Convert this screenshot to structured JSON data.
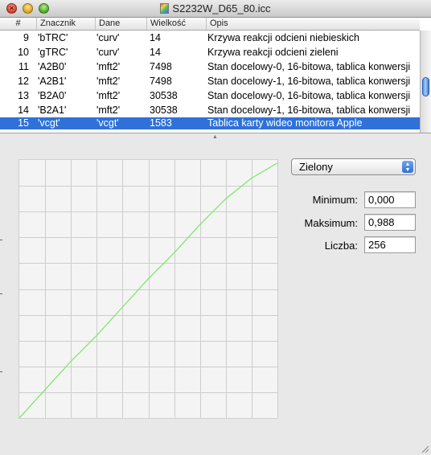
{
  "window": {
    "title": "S2232W_D65_80.icc"
  },
  "table": {
    "headers": [
      "#",
      "Znacznik",
      "Dane",
      "Wielkość",
      "Opis"
    ],
    "rows": [
      {
        "n": "9",
        "tag": "'bTRC'",
        "data": "'curv'",
        "size": "14",
        "desc": "Krzywa reakcji odcieni niebieskich"
      },
      {
        "n": "10",
        "tag": "'gTRC'",
        "data": "'curv'",
        "size": "14",
        "desc": "Krzywa reakcji odcieni zieleni"
      },
      {
        "n": "11",
        "tag": "'A2B0'",
        "data": "'mft2'",
        "size": "7498",
        "desc": "Stan docelowy-0, 16-bitowa, tablica konwersji"
      },
      {
        "n": "12",
        "tag": "'A2B1'",
        "data": "'mft2'",
        "size": "7498",
        "desc": "Stan docelowy-1, 16-bitowa, tablica konwersji"
      },
      {
        "n": "13",
        "tag": "'B2A0'",
        "data": "'mft2'",
        "size": "30538",
        "desc": "Stan docelowy-0, 16-bitowa, tablica konwersji"
      },
      {
        "n": "14",
        "tag": "'B2A1'",
        "data": "'mft2'",
        "size": "30538",
        "desc": "Stan docelowy-1, 16-bitowa, tablica konwersji"
      },
      {
        "n": "15",
        "tag": "'vcgt'",
        "data": "'vcgt'",
        "size": "1583",
        "desc": "Tablica karty wideo monitora Apple"
      }
    ],
    "selected_index": 6
  },
  "channel": {
    "selected": "Zielony"
  },
  "stats": {
    "minimum_label": "Minimum:",
    "minimum_value": "0,000",
    "maximum_label": "Maksimum:",
    "maximum_value": "0,988",
    "count_label": "Liczba:",
    "count_value": "256"
  },
  "colors": {
    "curve": "#7ee86a",
    "selection": "#2f71d8",
    "grid": "#cdcdcd"
  },
  "chart_data": {
    "type": "line",
    "title": "",
    "xlabel": "",
    "ylabel": "",
    "xlim": [
      0,
      1
    ],
    "ylim": [
      0,
      1
    ],
    "grid": true,
    "series": [
      {
        "x": [
          0.0,
          0.1,
          0.2,
          0.3,
          0.4,
          0.5,
          0.6,
          0.7,
          0.8,
          0.9,
          1.0
        ],
        "y": [
          0.0,
          0.11,
          0.22,
          0.32,
          0.43,
          0.54,
          0.64,
          0.75,
          0.85,
          0.93,
          0.988
        ]
      }
    ]
  }
}
